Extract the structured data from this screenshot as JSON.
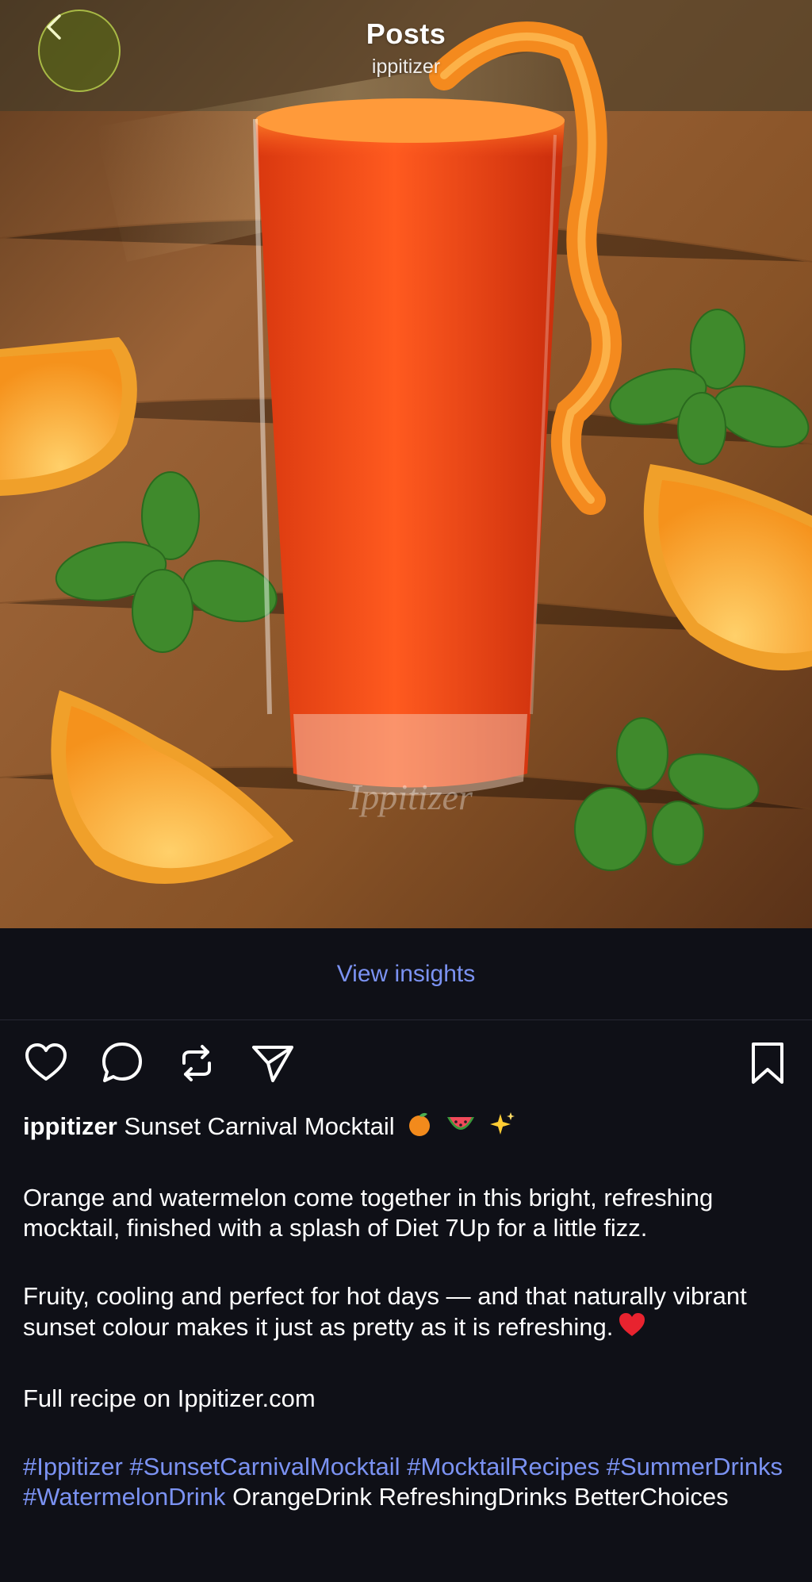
{
  "header": {
    "title": "Posts",
    "subtitle": "ippitizer",
    "back_icon": "chevron-left-icon"
  },
  "photo": {
    "watermark": "Ippitizer",
    "colors": {
      "drink": "#e8421a",
      "orange": "#f39a1f",
      "mint": "#3f8a2c",
      "wood": "#7a4826"
    }
  },
  "insights": {
    "label": "View insights"
  },
  "actions": {
    "like_icon": "heart-icon",
    "comment_icon": "comment-icon",
    "repost_icon": "repost-icon",
    "share_icon": "send-icon",
    "save_icon": "bookmark-icon"
  },
  "caption": {
    "username": "ippitizer",
    "title": "Sunset Carnival Mocktail",
    "title_emojis": [
      "orange-emoji",
      "watermelon-emoji",
      "sparkles-emoji"
    ],
    "para1": "Orange and watermelon come together in this bright, refreshing mocktail, finished with a splash of Diet 7Up for a little fizz.",
    "para2": "Fruity, cooling and perfect for hot days — and that naturally vibrant sunset colour makes it just as pretty as it is refreshing.",
    "para2_emoji": "red-heart-emoji",
    "para3": "Full recipe on Ippitizer.com",
    "hashtags": [
      "#Ippitizer",
      "#SunsetCarnivalMocktail",
      "#MocktailRecipes",
      "#SummerDrinks",
      "#WatermelonDrink"
    ],
    "plain_tail": "OrangeDrink RefreshingDrinks BetterChoices"
  },
  "colors": {
    "background": "#0f1017",
    "link": "#7b92f2",
    "text": "#ffffff"
  }
}
